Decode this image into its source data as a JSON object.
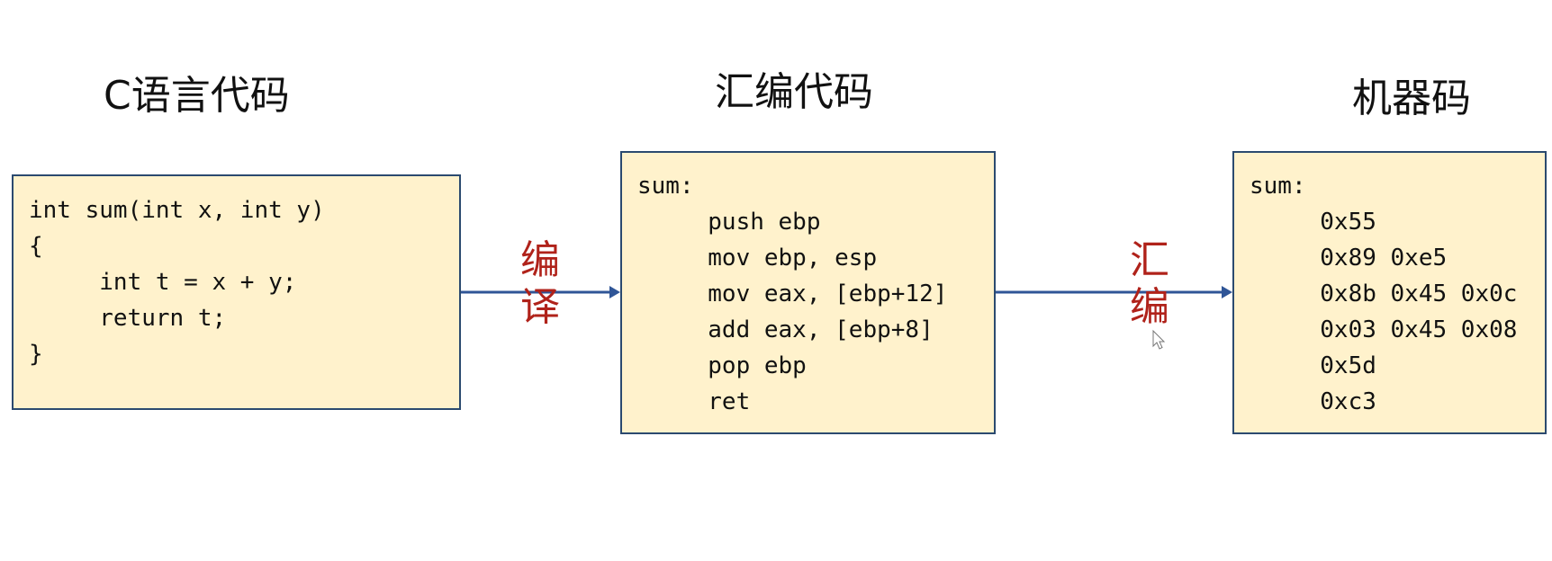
{
  "titles": {
    "c_code": "C语言代码",
    "assembly": "汇编代码",
    "machine": "机器码"
  },
  "c_box": {
    "lines": [
      "int sum(int x, int y)",
      "{",
      "     int t = x + y;",
      "     return t;",
      "}"
    ]
  },
  "asm_box": {
    "lines": [
      "sum:",
      "     push ebp",
      "     mov ebp, esp",
      "     mov eax, [ebp+12]",
      "     add eax, [ebp+8]",
      "     pop ebp",
      "     ret"
    ]
  },
  "machine_box": {
    "lines": [
      "sum:",
      "     0x55",
      "     0x89 0xe5",
      "     0x8b 0x45 0x0c",
      "     0x03 0x45 0x08",
      "     0x5d",
      "     0xc3"
    ]
  },
  "arrows": {
    "compile": {
      "chars": [
        "编",
        "译"
      ]
    },
    "assemble": {
      "chars": [
        "汇",
        "编"
      ]
    }
  },
  "colors": {
    "box_fill": "#fff2cc",
    "box_border": "#2b4a6f",
    "arrow": "#2f5597",
    "arrow_label": "#b0221a"
  }
}
